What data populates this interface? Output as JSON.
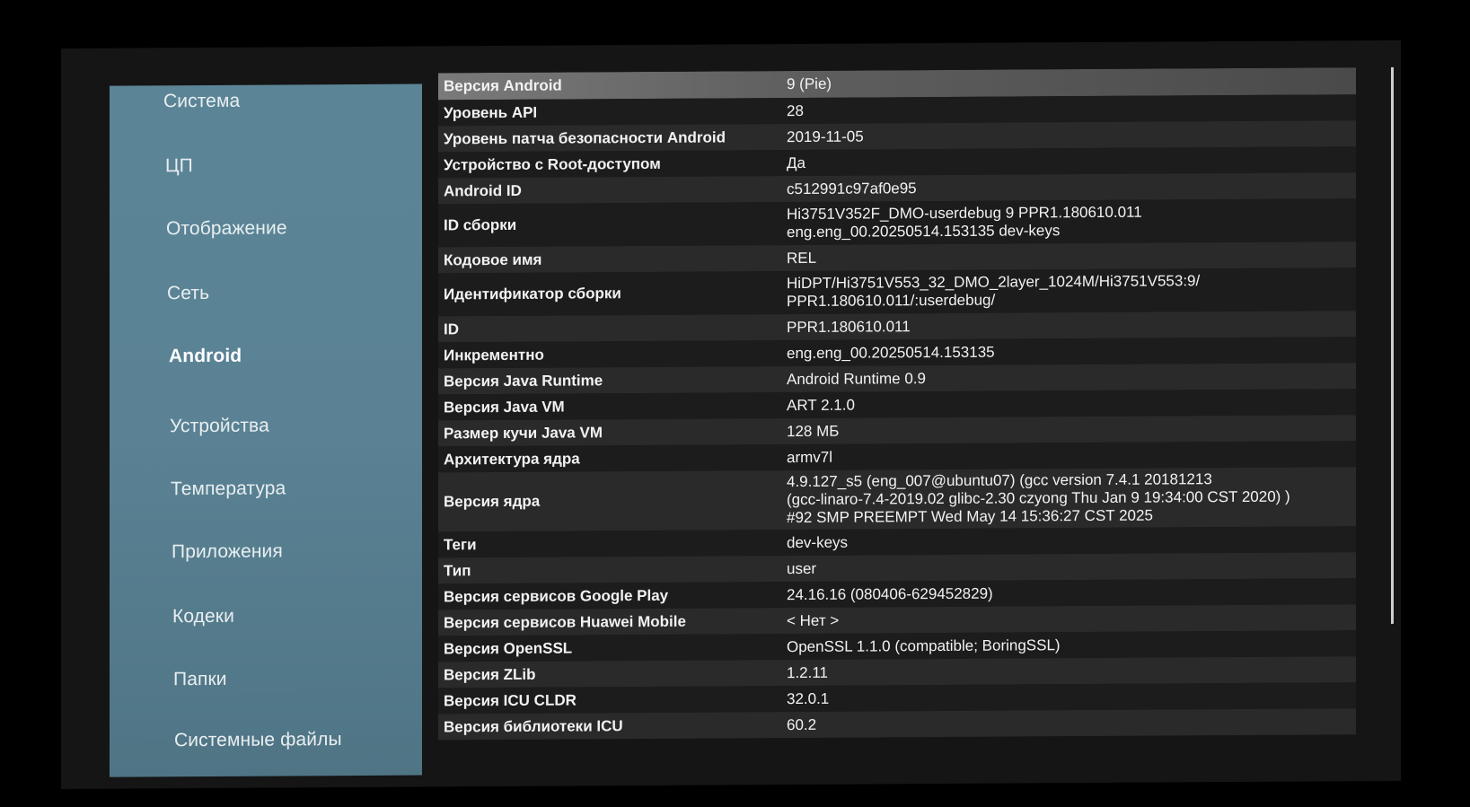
{
  "sidebar": {
    "items": [
      {
        "label": "Система"
      },
      {
        "label": "ЦП"
      },
      {
        "label": "Отображение"
      },
      {
        "label": "Сеть"
      },
      {
        "label": "Android",
        "active": true
      },
      {
        "label": "Устройства"
      },
      {
        "label": "Температура"
      },
      {
        "label": "Приложения"
      },
      {
        "label": "Кодеки"
      },
      {
        "label": "Папки"
      },
      {
        "label": "Системные файлы"
      }
    ]
  },
  "info": {
    "rows": [
      {
        "label": "Версия Android",
        "value": "9 (Pie)"
      },
      {
        "label": "Уровень API",
        "value": "28"
      },
      {
        "label": "Уровень патча безопасности Android",
        "value": "2019-11-05"
      },
      {
        "label": "Устройство с Root-доступом",
        "value": "Да"
      },
      {
        "label": "Android ID",
        "value": "c512991c97af0e95"
      },
      {
        "label": "ID сборки",
        "value": "Hi3751V352F_DMO-userdebug 9 PPR1.180610.011\neng.eng_00.20250514.153135 dev-keys"
      },
      {
        "label": "Кодовое имя",
        "value": "REL"
      },
      {
        "label": "Идентификатор сборки",
        "value": "HiDPT/Hi3751V553_32_DMO_2layer_1024M/Hi3751V553:9/\nPPR1.180610.011/:userdebug/"
      },
      {
        "label": "ID",
        "value": "PPR1.180610.011"
      },
      {
        "label": "Инкрементно",
        "value": "eng.eng_00.20250514.153135"
      },
      {
        "label": "Версия Java Runtime",
        "value": "Android Runtime 0.9"
      },
      {
        "label": "Версия Java VM",
        "value": "ART 2.1.0"
      },
      {
        "label": "Размер кучи Java VM",
        "value": "128 МБ"
      },
      {
        "label": "Архитектура ядра",
        "value": "armv7l"
      },
      {
        "label": "Версия ядра",
        "value": "4.9.127_s5 (eng_007@ubuntu07) (gcc version 7.4.1 20181213\n(gcc-linaro-7.4-2019.02 glibc-2.30 czyong Thu Jan 9 19:34:00 CST 2020) )\n#92 SMP PREEMPT Wed May 14 15:36:27 CST 2025"
      },
      {
        "label": "Теги",
        "value": "dev-keys"
      },
      {
        "label": "Тип",
        "value": "user"
      },
      {
        "label": "Версия сервисов Google Play",
        "value": "24.16.16 (080406-629452829)"
      },
      {
        "label": "Версия сервисов Huawei Mobile",
        "value": "< Нет >"
      },
      {
        "label": "Версия OpenSSL",
        "value": "OpenSSL 1.1.0 (compatible; BoringSSL)"
      },
      {
        "label": "Версия ZLib",
        "value": "1.2.11"
      },
      {
        "label": "Версия ICU CLDR",
        "value": "32.0.1"
      },
      {
        "label": "Версия библиотеки ICU",
        "value": "60.2"
      }
    ]
  }
}
